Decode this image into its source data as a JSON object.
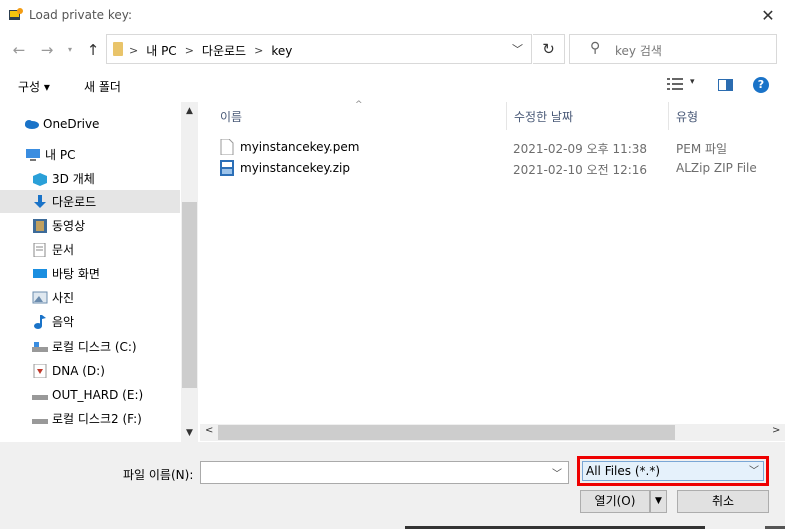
{
  "window": {
    "title": "Load private key:"
  },
  "address": {
    "crumbs": [
      "내 PC",
      "다운로드",
      "key"
    ]
  },
  "search": {
    "placeholder": "key 검색"
  },
  "toolbar": {
    "organize_label": "구성 ▾",
    "new_folder_label": "새 폴더",
    "help_label": "?"
  },
  "nav": {
    "items": [
      {
        "label": "OneDrive",
        "icon": "cloud-icon",
        "color": "#1a73c8"
      },
      {
        "label": "내 PC",
        "icon": "computer-icon",
        "color": "#3a8de0"
      },
      {
        "label": "3D 개체",
        "icon": "cube-icon",
        "color": "#2aa0d8"
      },
      {
        "label": "다운로드",
        "icon": "download-icon",
        "color": "#1a73c8"
      },
      {
        "label": "동영상",
        "icon": "video-icon",
        "color": "#555555"
      },
      {
        "label": "문서",
        "icon": "document-icon",
        "color": "#8a8a8a"
      },
      {
        "label": "바탕 화면",
        "icon": "desktop-icon",
        "color": "#1a8ee0"
      },
      {
        "label": "사진",
        "icon": "picture-icon",
        "color": "#6b8cae"
      },
      {
        "label": "음악",
        "icon": "music-icon",
        "color": "#1a73c8"
      },
      {
        "label": "로컬 디스크 (C:)",
        "icon": "drive-icon",
        "color": "#888888"
      },
      {
        "label": "DNA (D:)",
        "icon": "drive-icon",
        "color": "#c0392b"
      },
      {
        "label": "OUT_HARD (E:)",
        "icon": "drive-icon",
        "color": "#888888"
      },
      {
        "label": "로컬 디스크2 (F:)",
        "icon": "drive-icon",
        "color": "#888888"
      }
    ]
  },
  "columns": {
    "name": "이름",
    "date": "수정한 날짜",
    "type": "유형"
  },
  "files": [
    {
      "name": "myinstancekey.pem",
      "date": "2021-02-09 오후 11:38",
      "type": "PEM 파일"
    },
    {
      "name": "myinstancekey.zip",
      "date": "2021-02-10 오전 12:16",
      "type": "ALZip ZIP File"
    }
  ],
  "bottom": {
    "filename_label": "파일 이름(N):",
    "filename_value": "",
    "filetype_value": "All Files (*.*)",
    "open_label": "열기(O)",
    "cancel_label": "취소"
  },
  "colors": {
    "highlight": "#ee0000",
    "accent": "#1a73c8"
  }
}
